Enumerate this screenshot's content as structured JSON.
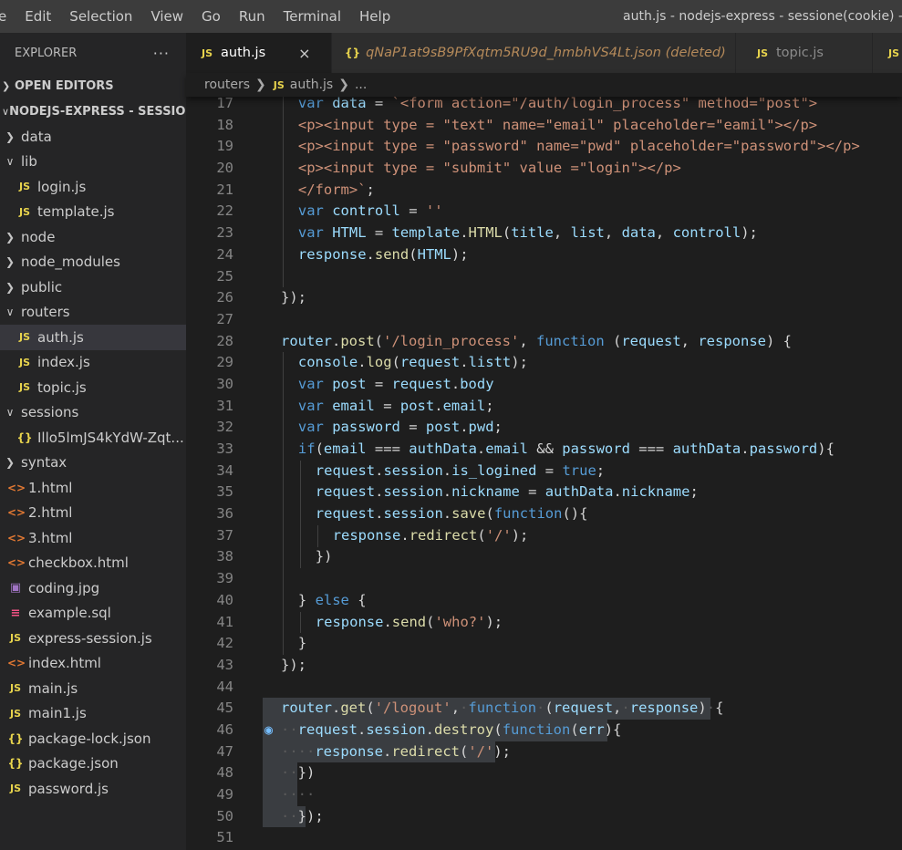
{
  "menubar": {
    "items": [
      "e",
      "Edit",
      "Selection",
      "View",
      "Go",
      "Run",
      "Terminal",
      "Help"
    ],
    "window_title": "auth.js - nodejs-express - sessione(cookie) - Vi"
  },
  "sidebar": {
    "title": "EXPLORER",
    "more": "···",
    "open_editors": "OPEN EDITORS",
    "project": "NODEJS-EXPRESS - SESSIO...",
    "tree": [
      {
        "label": "data",
        "type": "folder",
        "open": false,
        "depth": 0
      },
      {
        "label": "lib",
        "type": "folder",
        "open": true,
        "depth": 0
      },
      {
        "label": "login.js",
        "type": "js",
        "depth": 1
      },
      {
        "label": "template.js",
        "type": "js",
        "depth": 1
      },
      {
        "label": "node",
        "type": "folder",
        "open": false,
        "depth": 0
      },
      {
        "label": "node_modules",
        "type": "folder",
        "open": false,
        "depth": 0
      },
      {
        "label": "public",
        "type": "folder",
        "open": false,
        "depth": 0
      },
      {
        "label": "routers",
        "type": "folder",
        "open": true,
        "depth": 0
      },
      {
        "label": "auth.js",
        "type": "js",
        "depth": 1,
        "active": true
      },
      {
        "label": "index.js",
        "type": "js",
        "depth": 1
      },
      {
        "label": "topic.js",
        "type": "js",
        "depth": 1
      },
      {
        "label": "sessions",
        "type": "folder",
        "open": true,
        "depth": 0
      },
      {
        "label": "Illo5lmJS4kYdW-Zqt...",
        "type": "json",
        "depth": 1
      },
      {
        "label": "syntax",
        "type": "folder",
        "open": false,
        "depth": 0
      },
      {
        "label": "1.html",
        "type": "html",
        "depth": 0
      },
      {
        "label": "2.html",
        "type": "html",
        "depth": 0
      },
      {
        "label": "3.html",
        "type": "html",
        "depth": 0
      },
      {
        "label": "checkbox.html",
        "type": "html",
        "depth": 0
      },
      {
        "label": "coding.jpg",
        "type": "img",
        "depth": 0
      },
      {
        "label": "example.sql",
        "type": "sql",
        "depth": 0
      },
      {
        "label": "express-session.js",
        "type": "js",
        "depth": 0
      },
      {
        "label": "index.html",
        "type": "html",
        "depth": 0
      },
      {
        "label": "main.js",
        "type": "js",
        "depth": 0
      },
      {
        "label": "main1.js",
        "type": "js",
        "depth": 0
      },
      {
        "label": "package-lock.json",
        "type": "json",
        "depth": 0
      },
      {
        "label": "package.json",
        "type": "json",
        "depth": 0
      },
      {
        "label": "password.js",
        "type": "js",
        "depth": 0
      }
    ]
  },
  "tabs": [
    {
      "label": "auth.js",
      "icon": "JS",
      "active": true,
      "close": "×"
    },
    {
      "label": "qNaP1at9sB9PfXqtm5RU9d_hmbhVS4Lt.json (deleted)",
      "icon": "{}",
      "active": false
    },
    {
      "label": "topic.js",
      "icon": "JS",
      "active": false
    },
    {
      "label": "",
      "icon": "JS",
      "active": false
    }
  ],
  "breadcrumb": {
    "folder": "routers",
    "file_icon": "JS",
    "file": "auth.js",
    "more": "..."
  },
  "code": [
    {
      "n": 17,
      "indent": 1,
      "t": [
        [
          "var ",
          "kw"
        ],
        [
          "data",
          "var"
        ],
        [
          " = ",
          "pl"
        ],
        [
          "`<form action=\"/auth/login_process\" method=\"post\">",
          "str"
        ]
      ]
    },
    {
      "n": 18,
      "indent": 1,
      "t": [
        [
          "<p><input type = \"text\" name=\"email\" placeholder=\"eamil\"></p>",
          "str"
        ]
      ]
    },
    {
      "n": 19,
      "indent": 1,
      "t": [
        [
          "<p><input type = \"password\" name=\"pwd\" placeholder=\"password\"></p>",
          "str"
        ]
      ]
    },
    {
      "n": 20,
      "indent": 1,
      "t": [
        [
          "<p><input type = \"submit\" value =\"login\"></p>",
          "str"
        ]
      ]
    },
    {
      "n": 21,
      "indent": 1,
      "t": [
        [
          "</form>`",
          "str"
        ],
        [
          ";",
          "pl"
        ]
      ]
    },
    {
      "n": 22,
      "indent": 1,
      "t": [
        [
          "var ",
          "kw"
        ],
        [
          "controll",
          "var"
        ],
        [
          " = ",
          "pl"
        ],
        [
          "''",
          "str"
        ]
      ]
    },
    {
      "n": 23,
      "indent": 1,
      "t": [
        [
          "var ",
          "kw"
        ],
        [
          "HTML",
          "var"
        ],
        [
          " = ",
          "pl"
        ],
        [
          "template",
          "var"
        ],
        [
          ".",
          "pl"
        ],
        [
          "HTML",
          "fn"
        ],
        [
          "(",
          "pl"
        ],
        [
          "title",
          "var"
        ],
        [
          ", ",
          "pl"
        ],
        [
          "list",
          "var"
        ],
        [
          ", ",
          "pl"
        ],
        [
          "data",
          "var"
        ],
        [
          ", ",
          "pl"
        ],
        [
          "controll",
          "var"
        ],
        [
          ");",
          "pl"
        ]
      ]
    },
    {
      "n": 24,
      "indent": 1,
      "t": [
        [
          "response",
          "var"
        ],
        [
          ".",
          "pl"
        ],
        [
          "send",
          "fn"
        ],
        [
          "(",
          "pl"
        ],
        [
          "HTML",
          "var"
        ],
        [
          ");",
          "pl"
        ]
      ]
    },
    {
      "n": 25,
      "indent": 0,
      "t": []
    },
    {
      "n": 26,
      "indent": 0,
      "t": [
        [
          "});",
          "pl"
        ]
      ]
    },
    {
      "n": 27,
      "indent": 0,
      "t": []
    },
    {
      "n": 28,
      "indent": 0,
      "t": [
        [
          "router",
          "var"
        ],
        [
          ".",
          "pl"
        ],
        [
          "post",
          "fn"
        ],
        [
          "(",
          "pl"
        ],
        [
          "'/login_process'",
          "str"
        ],
        [
          ", ",
          "pl"
        ],
        [
          "function",
          "kw"
        ],
        [
          " (",
          "pl"
        ],
        [
          "request",
          "var"
        ],
        [
          ", ",
          "pl"
        ],
        [
          "response",
          "var"
        ],
        [
          ") {",
          "pl"
        ]
      ]
    },
    {
      "n": 29,
      "indent": 1,
      "t": [
        [
          "console",
          "var"
        ],
        [
          ".",
          "pl"
        ],
        [
          "log",
          "fn"
        ],
        [
          "(",
          "pl"
        ],
        [
          "request",
          "var"
        ],
        [
          ".",
          "pl"
        ],
        [
          "listt",
          "var"
        ],
        [
          ");",
          "pl"
        ]
      ]
    },
    {
      "n": 30,
      "indent": 1,
      "t": [
        [
          "var ",
          "kw"
        ],
        [
          "post",
          "var"
        ],
        [
          " = ",
          "pl"
        ],
        [
          "request",
          "var"
        ],
        [
          ".",
          "pl"
        ],
        [
          "body",
          "var"
        ]
      ]
    },
    {
      "n": 31,
      "indent": 1,
      "t": [
        [
          "var ",
          "kw"
        ],
        [
          "email",
          "var"
        ],
        [
          " = ",
          "pl"
        ],
        [
          "post",
          "var"
        ],
        [
          ".",
          "pl"
        ],
        [
          "email",
          "var"
        ],
        [
          ";",
          "pl"
        ]
      ]
    },
    {
      "n": 32,
      "indent": 1,
      "t": [
        [
          "var ",
          "kw"
        ],
        [
          "password",
          "var"
        ],
        [
          " = ",
          "pl"
        ],
        [
          "post",
          "var"
        ],
        [
          ".",
          "pl"
        ],
        [
          "pwd",
          "var"
        ],
        [
          ";",
          "pl"
        ]
      ]
    },
    {
      "n": 33,
      "indent": 1,
      "t": [
        [
          "if",
          "kw"
        ],
        [
          "(",
          "pl"
        ],
        [
          "email",
          "var"
        ],
        [
          " === ",
          "pl"
        ],
        [
          "authData",
          "var"
        ],
        [
          ".",
          "pl"
        ],
        [
          "email",
          "var"
        ],
        [
          " && ",
          "pl"
        ],
        [
          "password",
          "var"
        ],
        [
          " === ",
          "pl"
        ],
        [
          "authData",
          "var"
        ],
        [
          ".",
          "pl"
        ],
        [
          "password",
          "var"
        ],
        [
          "){",
          "pl"
        ]
      ]
    },
    {
      "n": 34,
      "indent": 2,
      "t": [
        [
          "request",
          "var"
        ],
        [
          ".",
          "pl"
        ],
        [
          "session",
          "var"
        ],
        [
          ".",
          "pl"
        ],
        [
          "is_logined",
          "var"
        ],
        [
          " = ",
          "pl"
        ],
        [
          "true",
          "kw"
        ],
        [
          ";",
          "pl"
        ]
      ]
    },
    {
      "n": 35,
      "indent": 2,
      "t": [
        [
          "request",
          "var"
        ],
        [
          ".",
          "pl"
        ],
        [
          "session",
          "var"
        ],
        [
          ".",
          "pl"
        ],
        [
          "nickname",
          "var"
        ],
        [
          " = ",
          "pl"
        ],
        [
          "authData",
          "var"
        ],
        [
          ".",
          "pl"
        ],
        [
          "nickname",
          "var"
        ],
        [
          ";",
          "pl"
        ]
      ]
    },
    {
      "n": 36,
      "indent": 2,
      "t": [
        [
          "request",
          "var"
        ],
        [
          ".",
          "pl"
        ],
        [
          "session",
          "var"
        ],
        [
          ".",
          "pl"
        ],
        [
          "save",
          "fn"
        ],
        [
          "(",
          "pl"
        ],
        [
          "function",
          "kw"
        ],
        [
          "(){",
          "pl"
        ]
      ]
    },
    {
      "n": 37,
      "indent": 3,
      "t": [
        [
          "response",
          "var"
        ],
        [
          ".",
          "pl"
        ],
        [
          "redirect",
          "fn"
        ],
        [
          "(",
          "pl"
        ],
        [
          "'/'",
          "str"
        ],
        [
          ");",
          "pl"
        ]
      ]
    },
    {
      "n": 38,
      "indent": 2,
      "t": [
        [
          "})",
          "pl"
        ]
      ]
    },
    {
      "n": 39,
      "indent": 0,
      "t": []
    },
    {
      "n": 40,
      "indent": 1,
      "t": [
        [
          "} ",
          "pl"
        ],
        [
          "else",
          "kw"
        ],
        [
          " {",
          "pl"
        ]
      ]
    },
    {
      "n": 41,
      "indent": 2,
      "t": [
        [
          "response",
          "var"
        ],
        [
          ".",
          "pl"
        ],
        [
          "send",
          "fn"
        ],
        [
          "(",
          "pl"
        ],
        [
          "'who?'",
          "str"
        ],
        [
          ");",
          "pl"
        ]
      ]
    },
    {
      "n": 42,
      "indent": 1,
      "t": [
        [
          "}",
          "pl"
        ]
      ]
    },
    {
      "n": 43,
      "indent": 0,
      "t": [
        [
          "});",
          "pl"
        ]
      ]
    },
    {
      "n": 44,
      "indent": 0,
      "t": []
    },
    {
      "n": 45,
      "indent": 0,
      "sel": true,
      "t": [
        [
          "router",
          "var"
        ],
        [
          ".",
          "pl"
        ],
        [
          "get",
          "fn"
        ],
        [
          "(",
          "pl"
        ],
        [
          "'/logout'",
          "str"
        ],
        [
          ",",
          "pl"
        ],
        [
          "·",
          "ws"
        ],
        [
          "function",
          "kw"
        ],
        [
          "·",
          "ws"
        ],
        [
          "(",
          "pl"
        ],
        [
          "request",
          "var"
        ],
        [
          ",",
          "pl"
        ],
        [
          "·",
          "ws"
        ],
        [
          "response",
          "var"
        ],
        [
          ")",
          "pl"
        ],
        [
          "·",
          "ws"
        ],
        [
          "{",
          "pl"
        ]
      ]
    },
    {
      "n": 46,
      "indent": 0,
      "sel": true,
      "bulb": true,
      "t": [
        [
          "··",
          "ws"
        ],
        [
          "request",
          "var"
        ],
        [
          ".",
          "pl"
        ],
        [
          "session",
          "var"
        ],
        [
          ".",
          "pl"
        ],
        [
          "destroy",
          "fn"
        ],
        [
          "(",
          "pl"
        ],
        [
          "function",
          "kw"
        ],
        [
          "(",
          "pl"
        ],
        [
          "err",
          "var"
        ],
        [
          "){",
          "pl"
        ]
      ]
    },
    {
      "n": 47,
      "indent": 0,
      "sel": true,
      "t": [
        [
          "····",
          "ws"
        ],
        [
          "response",
          "var"
        ],
        [
          ".",
          "pl"
        ],
        [
          "redirect",
          "fn"
        ],
        [
          "(",
          "pl"
        ],
        [
          "'/'",
          "str"
        ],
        [
          ");",
          "pl"
        ]
      ]
    },
    {
      "n": 48,
      "indent": 0,
      "sel": true,
      "t": [
        [
          "··",
          "ws"
        ],
        [
          "})",
          "pl"
        ]
      ]
    },
    {
      "n": 49,
      "indent": 0,
      "sel": true,
      "t": [
        [
          "····",
          "ws"
        ]
      ]
    },
    {
      "n": 50,
      "indent": 0,
      "sel": true,
      "t": [
        [
          "··",
          "ws"
        ],
        [
          "});",
          "pl"
        ]
      ]
    },
    {
      "n": 51,
      "indent": 0,
      "t": []
    }
  ]
}
